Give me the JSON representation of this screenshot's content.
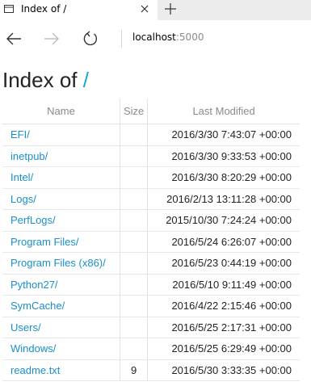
{
  "tab": {
    "title": "Index of /"
  },
  "address_bar": {
    "host": "localhost",
    "port": ":5000"
  },
  "page": {
    "heading": "Index of",
    "path": "/"
  },
  "table": {
    "headers": {
      "name": "Name",
      "size": "Size",
      "modified": "Last Modified"
    },
    "rows": [
      {
        "name": "EFI/",
        "size": "",
        "modified": "2016/3/30 7:43:07 +00:00"
      },
      {
        "name": "inetpub/",
        "size": "",
        "modified": "2016/3/30 9:33:53 +00:00"
      },
      {
        "name": "Intel/",
        "size": "",
        "modified": "2016/3/30 8:20:29 +00:00"
      },
      {
        "name": "Logs/",
        "size": "",
        "modified": "2016/2/13 13:11:28 +00:00"
      },
      {
        "name": "PerfLogs/",
        "size": "",
        "modified": "2015/10/30 7:24:24 +00:00"
      },
      {
        "name": "Program Files/",
        "size": "",
        "modified": "2016/5/24 6:26:07 +00:00"
      },
      {
        "name": "Program Files (x86)/",
        "size": "",
        "modified": "2016/5/23 0:44:19 +00:00"
      },
      {
        "name": "Python27/",
        "size": "",
        "modified": "2016/5/10 9:11:49 +00:00"
      },
      {
        "name": "SymCache/",
        "size": "",
        "modified": "2016/4/22 2:15:46 +00:00"
      },
      {
        "name": "Users/",
        "size": "",
        "modified": "2016/5/25 2:17:31 +00:00"
      },
      {
        "name": "Windows/",
        "size": "",
        "modified": "2016/5/25 6:29:49 +00:00"
      },
      {
        "name": "readme.txt",
        "size": "9",
        "modified": "2016/5/30 3:33:35 +00:00"
      }
    ]
  },
  "colors": {
    "link": "#1a8fc9",
    "path_accent": "#1aa6d8",
    "header_text": "#8a8a8a"
  },
  "icons": {
    "tab": "page-icon",
    "close": "close-icon",
    "new_tab": "plus-icon",
    "back": "back-arrow-icon",
    "forward": "forward-arrow-icon",
    "refresh": "refresh-icon"
  }
}
